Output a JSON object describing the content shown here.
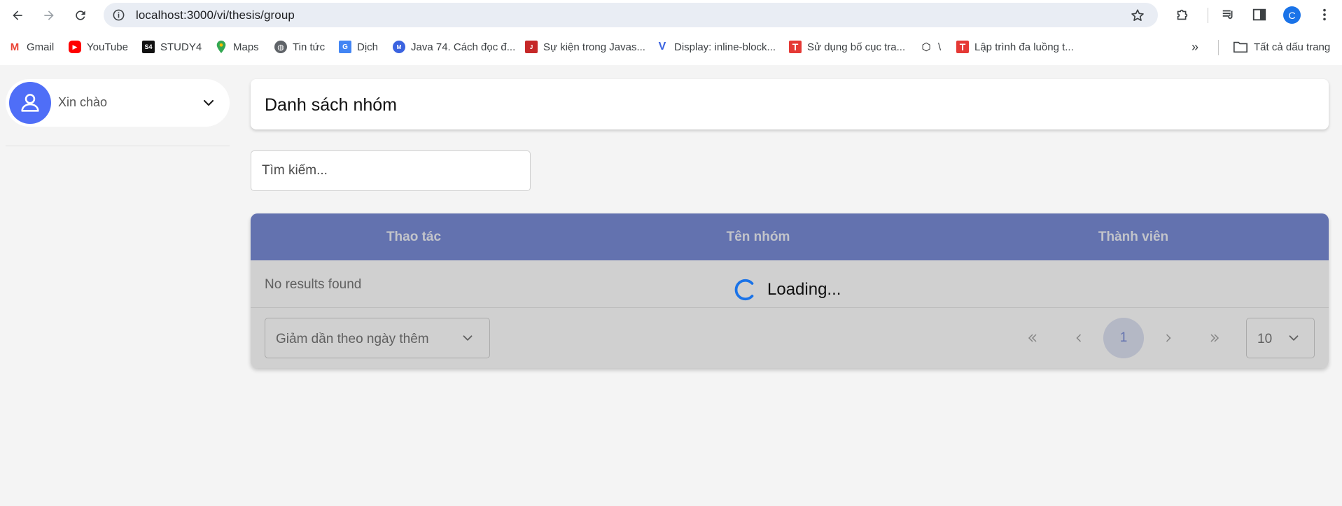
{
  "browser": {
    "url": "localhost:3000/vi/thesis/group",
    "profile_initial": "C",
    "bookmarks": [
      {
        "label": "Gmail",
        "icon": "gmail-icon"
      },
      {
        "label": "YouTube",
        "icon": "youtube-icon"
      },
      {
        "label": "STUDY4",
        "icon": "study4-icon"
      },
      {
        "label": "Maps",
        "icon": "maps-icon"
      },
      {
        "label": "Tin tức",
        "icon": "globe-icon"
      },
      {
        "label": "Dịch",
        "icon": "translate-icon"
      },
      {
        "label": "Java 74. Cách đọc đ...",
        "icon": "site-icon"
      },
      {
        "label": "Sự kiện trong Javas...",
        "icon": "site-icon"
      },
      {
        "label": "Display: inline-block...",
        "icon": "v-icon"
      },
      {
        "label": "Sử dụng bố cục tra...",
        "icon": "t-icon"
      },
      {
        "label": "\\",
        "icon": "codepen-icon"
      },
      {
        "label": "Lập trình đa luồng t...",
        "icon": "t-icon"
      }
    ],
    "all_bookmarks_label": "Tất cả dấu trang"
  },
  "sidebar": {
    "greeting": "Xin chào"
  },
  "main": {
    "title": "Danh sách nhóm",
    "search_placeholder": "Tìm kiếm...",
    "table": {
      "columns": [
        "Thao tác",
        "Tên nhóm",
        "Thành viên"
      ],
      "empty_message": "No results found"
    },
    "sort_option": "Giảm dần theo ngày thêm",
    "pagination": {
      "current_page": "1",
      "page_size": "10"
    },
    "loading_text": "Loading..."
  },
  "colors": {
    "accent": "#3a55c4",
    "avatar": "#4f6ef7",
    "spinner": "#1a73e8"
  }
}
